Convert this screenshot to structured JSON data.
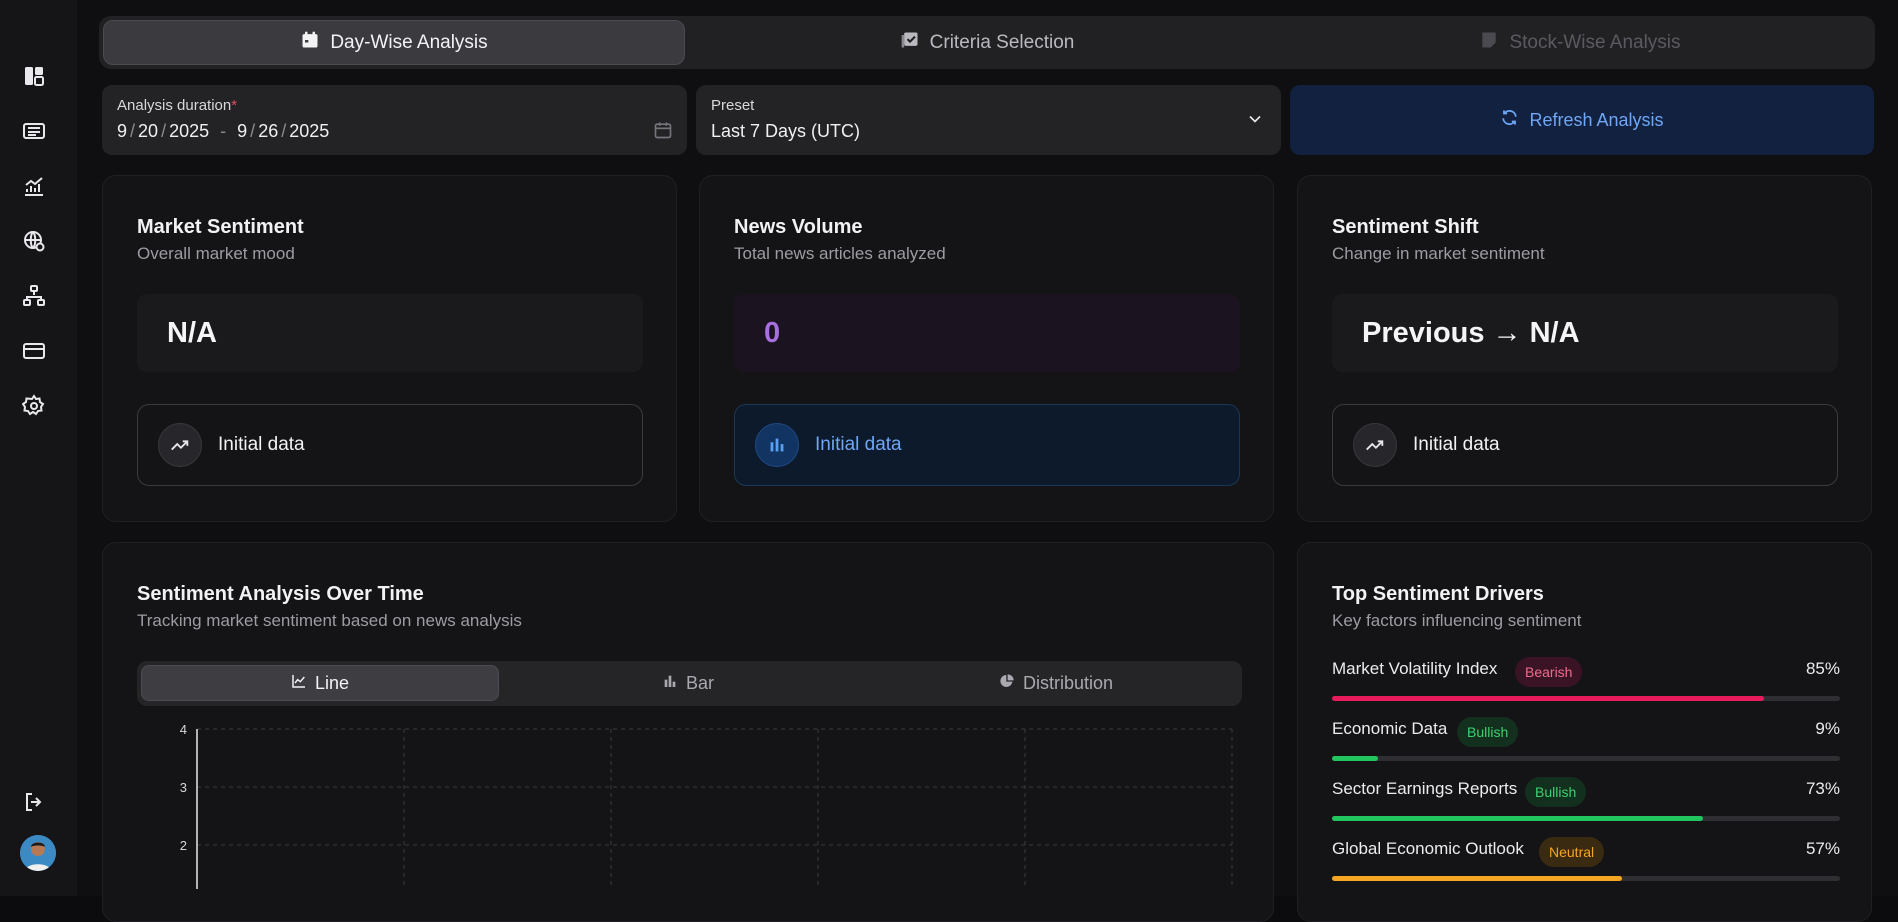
{
  "tabs": [
    {
      "label": "Day-Wise Analysis",
      "icon": "calendar-icon",
      "state": "active"
    },
    {
      "label": "Criteria Selection",
      "icon": "checklist-icon",
      "state": "normal"
    },
    {
      "label": "Stock-Wise Analysis",
      "icon": "note-icon",
      "state": "disabled"
    }
  ],
  "duration": {
    "label": "Analysis duration",
    "required": "*",
    "start": {
      "month": "9",
      "day": "20",
      "year": "2025"
    },
    "end": {
      "month": "9",
      "day": "26",
      "year": "2025"
    },
    "range_sep": "-",
    "date_sep": "/"
  },
  "preset": {
    "label": "Preset",
    "value": "Last 7 Days (UTC)"
  },
  "refresh_label": "Refresh Analysis",
  "cards": {
    "market": {
      "title": "Market Sentiment",
      "subtitle": "Overall market mood",
      "value": "N/A",
      "status": "Initial data"
    },
    "news": {
      "title": "News Volume",
      "subtitle": "Total news articles analyzed",
      "value": "0",
      "status": "Initial data"
    },
    "shift": {
      "title": "Sentiment Shift",
      "subtitle": "Change in market sentiment",
      "value": "Previous → N/A",
      "status": "Initial data"
    }
  },
  "sentiment_chart": {
    "title": "Sentiment Analysis Over Time",
    "subtitle": "Tracking market sentiment based on news analysis",
    "view_tabs": [
      {
        "label": "Line",
        "icon": "line-chart-icon",
        "state": "active"
      },
      {
        "label": "Bar",
        "icon": "bar-chart-icon",
        "state": "normal"
      },
      {
        "label": "Distribution",
        "icon": "pie-chart-icon",
        "state": "normal"
      }
    ]
  },
  "chart_data": {
    "type": "line",
    "title": "",
    "xlabel": "",
    "ylabel": "",
    "y_ticks": [
      "4",
      "3",
      "2"
    ],
    "ylim": [
      2,
      4
    ],
    "x_gridlines": 6,
    "grid": true,
    "series": []
  },
  "drivers": {
    "title": "Top Sentiment Drivers",
    "subtitle": "Key factors influencing sentiment",
    "items": [
      {
        "name": "Market Volatility Index",
        "badge": "Bearish",
        "percent_label": "85%",
        "value": 85,
        "color": "#e81b5d",
        "badge_bg": "#3a1424",
        "badge_fg": "#f06b8e"
      },
      {
        "name": "Economic Data",
        "badge": "Bullish",
        "percent_label": "9%",
        "value": 9,
        "color": "#22c55e",
        "badge_bg": "#13301f",
        "badge_fg": "#3fcf6f"
      },
      {
        "name": "Sector Earnings Reports",
        "badge": "Bullish",
        "percent_label": "73%",
        "value": 73,
        "color": "#22c55e",
        "badge_bg": "#13301f",
        "badge_fg": "#3fcf6f"
      },
      {
        "name": "Global Economic Outlook",
        "badge": "Neutral",
        "percent_label": "57%",
        "value": 57,
        "color": "#f5a524",
        "badge_bg": "#3a2a12",
        "badge_fg": "#f5a524"
      }
    ]
  },
  "sidebar_icons": [
    "dashboard-icon",
    "news-icon",
    "analytics-icon",
    "globe-settings-icon",
    "hierarchy-icon",
    "card-icon",
    "settings-icon",
    "logout-icon"
  ]
}
